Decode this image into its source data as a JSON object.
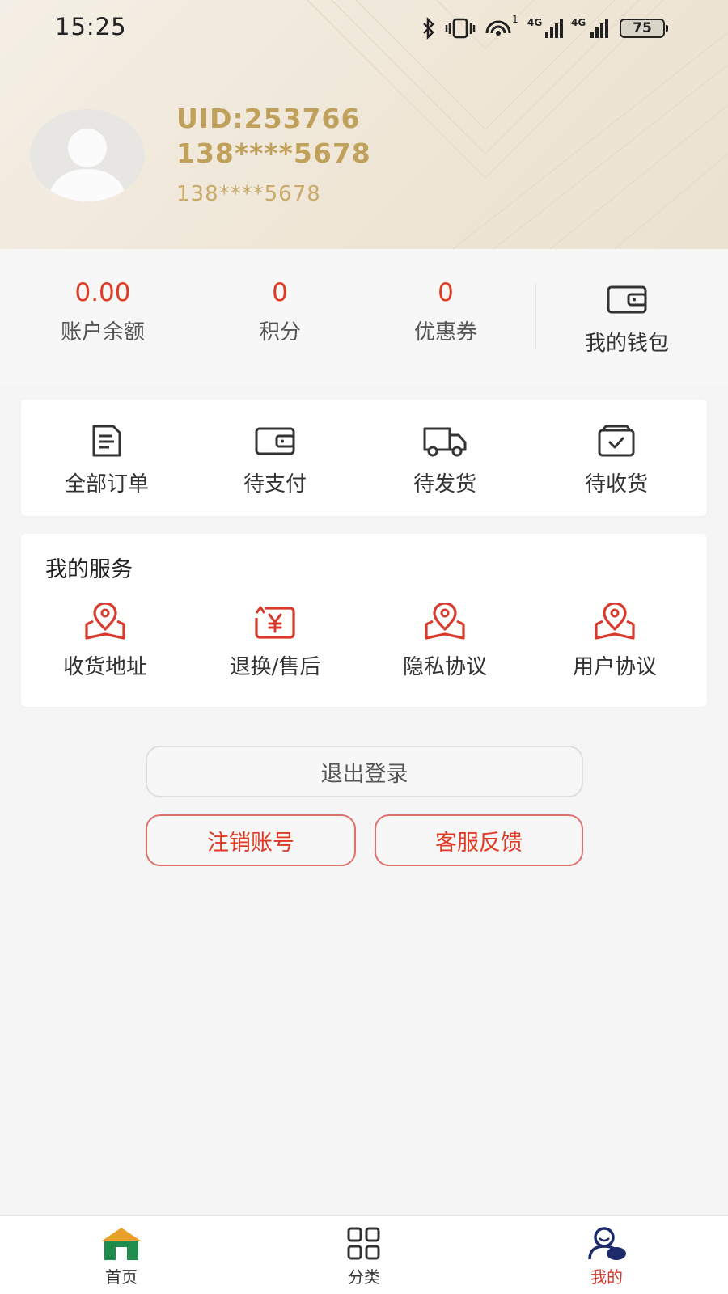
{
  "status_bar": {
    "time": "15:25",
    "battery": "75",
    "network_labels": [
      "1",
      "4G",
      "4G"
    ],
    "icons": [
      "bluetooth-icon",
      "vibrate-icon",
      "hotspot-icon",
      "signal-4g-icon",
      "signal-4g-icon",
      "battery-icon"
    ]
  },
  "profile": {
    "uid": "UID:253766",
    "phone_bold": "138****5678",
    "phone_small": "138****5678",
    "avatar_icon": "default-avatar-icon"
  },
  "stats": {
    "items": [
      {
        "value": "0.00",
        "label": "账户余额"
      },
      {
        "value": "0",
        "label": "积分"
      },
      {
        "value": "0",
        "label": "优惠券"
      }
    ],
    "wallet": {
      "label": "我的钱包",
      "icon": "wallet-icon"
    }
  },
  "orders": {
    "items": [
      {
        "label": "全部订单",
        "icon": "document-icon"
      },
      {
        "label": "待支付",
        "icon": "wallet-icon"
      },
      {
        "label": "待发货",
        "icon": "truck-icon"
      },
      {
        "label": "待收货",
        "icon": "box-check-icon"
      }
    ]
  },
  "services": {
    "title": "我的服务",
    "items": [
      {
        "label": "收货地址",
        "icon": "location-map-icon"
      },
      {
        "label": "退换/售后",
        "icon": "refund-yen-icon"
      },
      {
        "label": "隐私协议",
        "icon": "location-map-icon"
      },
      {
        "label": "用户协议",
        "icon": "location-map-icon"
      }
    ]
  },
  "buttons": {
    "logout": "退出登录",
    "cancel_account": "注销账号",
    "feedback": "客服反馈"
  },
  "tabbar": {
    "items": [
      {
        "label": "首页",
        "icon": "home-icon",
        "active": false
      },
      {
        "label": "分类",
        "icon": "grid-icon",
        "active": false
      },
      {
        "label": "我的",
        "icon": "user-icon",
        "active": true
      }
    ]
  },
  "colors": {
    "accent_red": "#e03a24",
    "gold": "#c0a15c",
    "background": "#f5f5f5",
    "home_green": "#1e8c4a",
    "home_roof": "#e8a02a",
    "user_navy": "#1c2a6b"
  }
}
